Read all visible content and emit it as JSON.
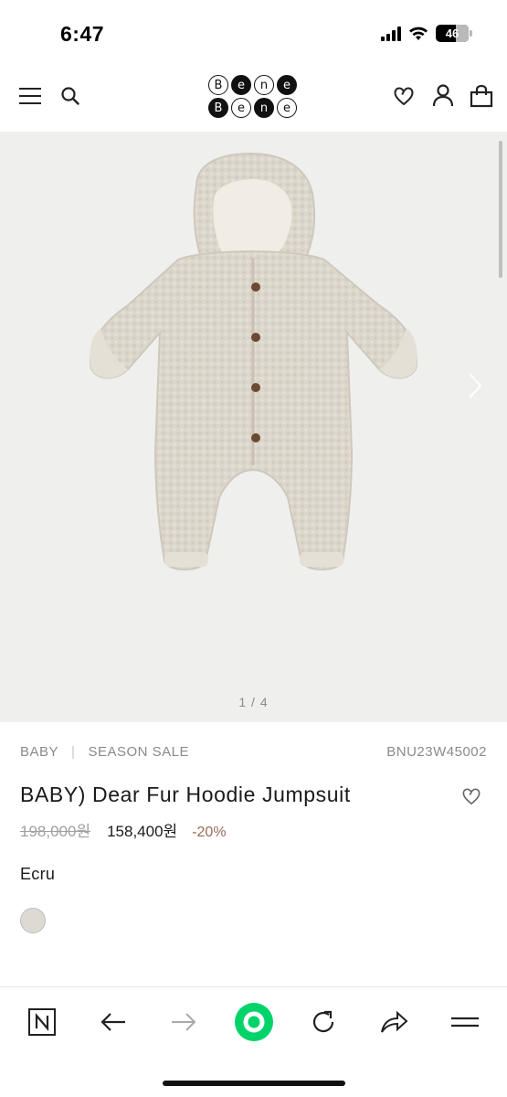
{
  "status_bar": {
    "time": "6:47",
    "battery": "46"
  },
  "header": {
    "logo_row1": [
      "B",
      "e",
      "n",
      "e"
    ],
    "logo_row2": [
      "B",
      "e",
      "n",
      "e"
    ]
  },
  "gallery": {
    "counter": "1 / 4",
    "current_index": 1,
    "total": 4
  },
  "product": {
    "category": "BABY",
    "collection": "SEASON SALE",
    "sku": "BNU23W45002",
    "title": "BABY) Dear Fur Hoodie Jumpsuit",
    "original_price": "198,000원",
    "sale_price": "158,400원",
    "discount": "-20%",
    "color_name": "Ecru",
    "swatch_color": "#dedad3"
  },
  "colors": {
    "accent_discount": "#9b6a5a",
    "browser_accent": "#00d36a",
    "gallery_bg": "#efefee"
  },
  "toolbar": {
    "icons": [
      "naver-n-icon",
      "back-arrow-icon",
      "forward-arrow-icon",
      "green-dot-icon",
      "reload-icon",
      "share-icon",
      "menu-icon"
    ]
  }
}
